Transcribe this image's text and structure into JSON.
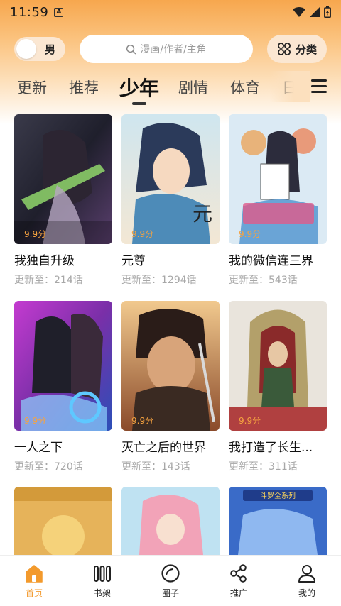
{
  "status_bar": {
    "time": "11:59",
    "notification_letter": "A"
  },
  "header": {
    "gender_label": "男",
    "search_placeholder": "漫画/作者/主角",
    "category_label": "分类"
  },
  "tabs": [
    {
      "label": "更新",
      "active": false
    },
    {
      "label": "推荐",
      "active": false
    },
    {
      "label": "少年",
      "active": true
    },
    {
      "label": "剧情",
      "active": false
    },
    {
      "label": "体育",
      "active": false
    },
    {
      "label": "日",
      "active": false
    }
  ],
  "comics": [
    {
      "title": "我独自升级",
      "score": "9.9分",
      "update": "更新至：214话"
    },
    {
      "title": "元尊",
      "score": "9.9分",
      "update": "更新至：1294话"
    },
    {
      "title": "我的微信连三界",
      "score": "9.9分",
      "update": "更新至：543话"
    },
    {
      "title": "一人之下",
      "score": "9.9分",
      "update": "更新至：720话"
    },
    {
      "title": "灭亡之后的世界",
      "score": "9.9分",
      "update": "更新至：143话"
    },
    {
      "title": "我打造了长生...",
      "score": "9.9分",
      "update": "更新至：311话"
    }
  ],
  "partial_covers": {
    "third_cover_text": "斗罗全系列"
  },
  "bottom_nav": [
    {
      "label": "首页",
      "icon": "home-icon",
      "active": true
    },
    {
      "label": "书架",
      "icon": "bookshelf-icon",
      "active": false
    },
    {
      "label": "圈子",
      "icon": "circle-icon",
      "active": false
    },
    {
      "label": "推广",
      "icon": "share-icon",
      "active": false
    },
    {
      "label": "我的",
      "icon": "user-icon",
      "active": false
    }
  ],
  "colors": {
    "accent": "#f39a2d",
    "score": "#f6a340",
    "header_top": "#f7a74e"
  }
}
